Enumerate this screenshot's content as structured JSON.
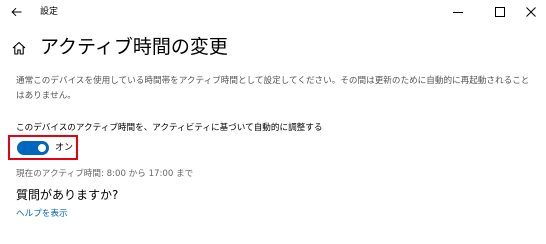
{
  "window": {
    "title": "設定",
    "back_icon": "back-arrow-icon",
    "minimize_icon": "minimize-icon",
    "maximize_icon": "maximize-icon",
    "close_icon": "close-icon"
  },
  "page": {
    "home_icon": "home-icon",
    "title": "アクティブ時間の変更",
    "description": "通常このデバイスを使用している時間帯をアクティブ時間として設定してください。その間は更新のために自動的に再起動されることはありません。"
  },
  "auto_adjust": {
    "label": "このデバイスのアクティブ時間を、アクティビティに基づいて自動的に調整する",
    "state_text": "オン",
    "enabled": true
  },
  "current_hours": {
    "text": "現在のアクティブ時間: 8:00 から 17:00 まで"
  },
  "help": {
    "heading": "質問がありますか?",
    "link": "ヘルプを表示"
  },
  "colors": {
    "accent": "#0067c0",
    "highlight_border": "#e60012"
  }
}
